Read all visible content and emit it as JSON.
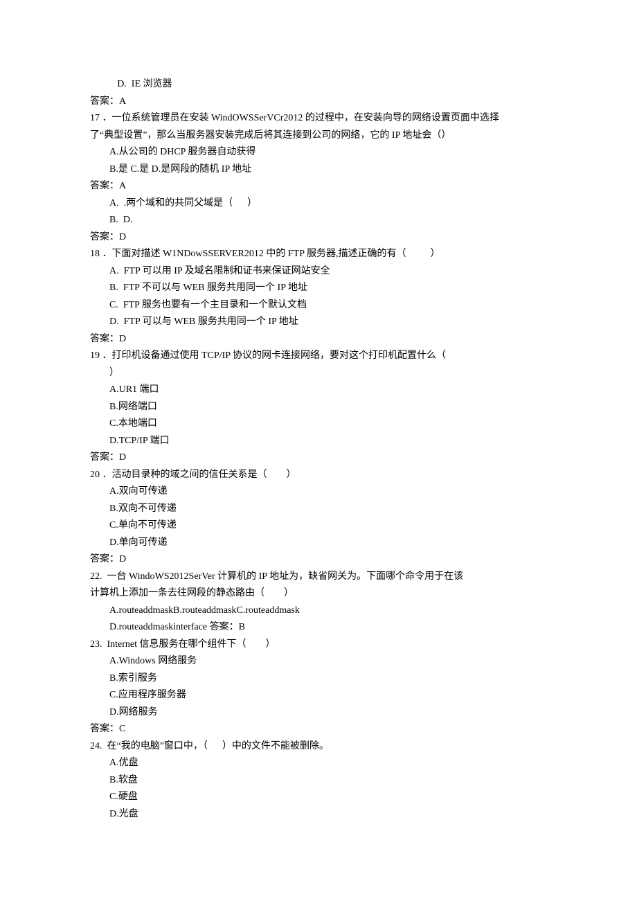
{
  "lines": {
    "l01": "D.  IE 浏览器",
    "l02": "答案：A",
    "l03": "17 ．一位系统管理员在安装 WindOWSSerVCr2012 的过程中，在安装向导的网络设置页面中选择",
    "l04": "了“典型设置”，那么当服务器安装完成后将其连接到公司的网络，它的 IP 地址会（）",
    "l05": "A.从公司的 DHCP 服务器自动获得",
    "l06": "B.是 C.是 D.是网段的随机 IP 地址",
    "l07": "答案：A",
    "l08": "A.  .两个域和的共同父域是（      ）",
    "l09": "B.  D.",
    "l10": "答案：D",
    "l11": "18 ．下面对描述 W1NDowSSERVER2012 中的 FTP 服务器,描述正确的有（          ）",
    "l12": "A.  FTP 可以用 IP 及域名限制和证书来保证网站安全",
    "l13": "B.  FTP 不可以与 WEB 服务共用同一个 IP 地址",
    "l14": "C.  FTP 服务也要有一个主目录和一个默认文档",
    "l15": "D.  FTP 可以与 WEB 服务共用同一个 IP 地址",
    "l16": "答案：D",
    "l17": "19 ．打印机设备通过使用 TCP/IP 协议的网卡连接网络，要对这个打印机配置什么（",
    "l18": "）",
    "l19": "A.UR1 端口",
    "l20": "B.网络端口",
    "l21": "C.本地端口",
    "l22": "D.TCP/IP 端口",
    "l23": "答案：D",
    "l24": "20 ．活动目录种的域之间的信任关系是（        ）",
    "l25": "A.双向可传递",
    "l26": "B.双向不可传递",
    "l27": "C.单向不可传递",
    "l28": "D.单向可传递",
    "l29": "答案：D",
    "l30": "22.  一台 WindoWS2012SerVer 计算机的 IP 地址为，缺省网关为。下面哪个命令用于在该",
    "l31": "计算机上添加一条去往网段的静态路由（        ）",
    "l32": "A.routeaddmaskB.routeaddmaskC.routeaddmask",
    "l33": "D.routeaddmaskinterface 答案：B",
    "l34": "23.  Internet 信息服务在哪个组件下（        ）",
    "l35": "A.Windows 网络服务",
    "l36": "B.索引服务",
    "l37": "C.应用程序服务器",
    "l38": "D.网络服务",
    "l39": "答案：C",
    "l40": "24.  在“我的电脑”窗口中，（      ）中的文件不能被删除。",
    "l41": "A.优盘",
    "l42": "B.软盘",
    "l43": "C.硬盘",
    "l44": "D.光盘"
  }
}
